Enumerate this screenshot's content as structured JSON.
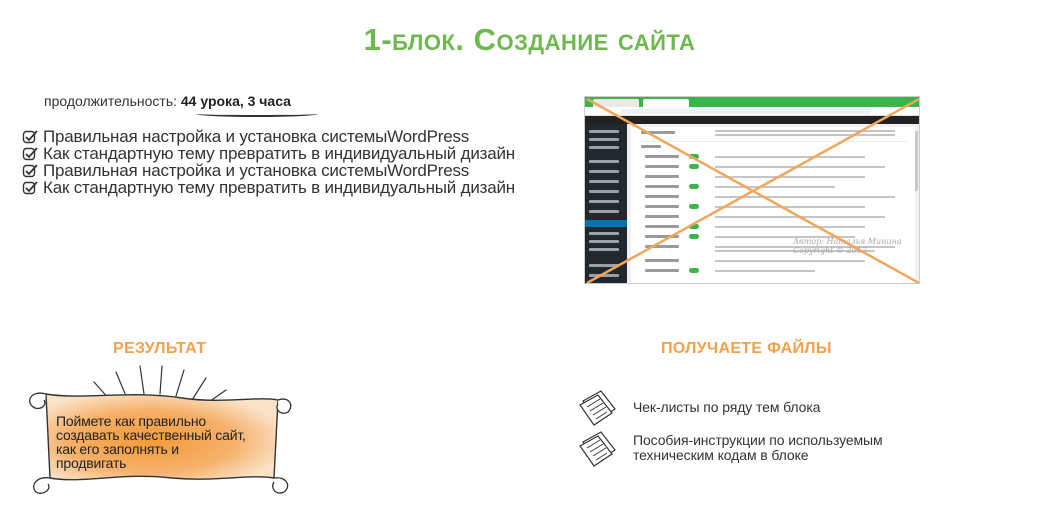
{
  "title": "1-блок. Создание сайта",
  "duration": {
    "label": "продолжительность: ",
    "value": "44 урока, 3 часа"
  },
  "checklist": [
    "Правильная настройка и установка системыWordPress",
    "Как стандартную тему превратить в индивидуальный дизайн",
    "Правильная настройка и установка системыWordPress",
    "Как стандартную тему превратить в индивидуальный дизайн"
  ],
  "screenshot": {
    "watermark_line1": "Автор: Наталья Минина",
    "watermark_line2": "Copyright © 2017"
  },
  "result": {
    "heading": "РЕЗУЛЬТАТ",
    "lines": [
      "Поймете как правильно",
      "создавать качественный сайт,",
      "как его заполнять и",
      "продвигать"
    ]
  },
  "files": {
    "heading": "ПОЛУЧАЕТЕ ФАЙЛЫ",
    "items": [
      {
        "lines": [
          "Чек-листы по ряду тем блока"
        ]
      },
      {
        "lines": [
          "Пособия-инструкции по используемым",
          "техническим кодам в блоке"
        ]
      }
    ]
  },
  "colors": {
    "title_green": "#6db84f",
    "heading_orange": "#f5a14a",
    "cross_orange": "#f2a65a"
  }
}
